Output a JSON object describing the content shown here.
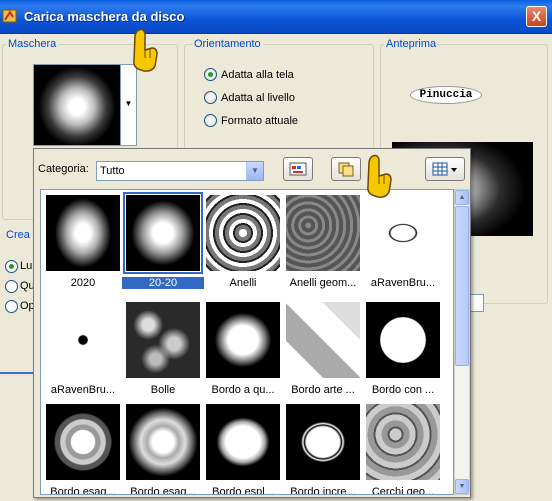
{
  "window": {
    "title": "Carica maschera da disco",
    "close_label": "X"
  },
  "maschera": {
    "label": "Maschera",
    "dropdown_glyph": "▼"
  },
  "orientamento": {
    "label": "Orientamento",
    "options": [
      {
        "label": "Adatta alla tela",
        "selected": true
      },
      {
        "label": "Adatta al livello",
        "selected": false
      },
      {
        "label": "Formato attuale",
        "selected": false
      }
    ]
  },
  "anteprima": {
    "label": "Anteprima",
    "signature": "Pinuccia"
  },
  "crea": {
    "label": "Crea",
    "options": [
      {
        "label": "Lu",
        "selected": true
      },
      {
        "label": "Qu",
        "selected": false
      },
      {
        "label": "Op",
        "selected": false
      }
    ]
  },
  "gallery": {
    "category_label": "Categoria:",
    "category_value": "Tutto",
    "toolbar_icons": [
      "edit-mask-icon",
      "copy-folder-icon",
      "view-options-icon"
    ],
    "items": [
      {
        "name": "2020",
        "selected": false
      },
      {
        "name": "20-20",
        "selected": true
      },
      {
        "name": "Anelli",
        "selected": false
      },
      {
        "name": "Anelli geom...",
        "selected": false
      },
      {
        "name": "aRavenBru...",
        "selected": false
      },
      {
        "name": "aRavenBru...",
        "selected": false
      },
      {
        "name": "Bolle",
        "selected": false
      },
      {
        "name": "Bordo a qu...",
        "selected": false
      },
      {
        "name": "Bordo arte ...",
        "selected": false
      },
      {
        "name": "Bordo con ...",
        "selected": false
      },
      {
        "name": "Bordo esag...",
        "selected": false
      },
      {
        "name": "Bordo esag...",
        "selected": false
      },
      {
        "name": "Bordo espl...",
        "selected": false
      },
      {
        "name": "Bordo incre...",
        "selected": false
      },
      {
        "name": "Cerchi geo...",
        "selected": false
      }
    ],
    "scroll": {
      "up_glyph": "▲",
      "down_glyph": "▼"
    }
  },
  "colors": {
    "title_bar": "#0a5fe0",
    "group_label": "#0046d5",
    "selection": "#316ac5",
    "hand_yellow": "#f5c800"
  }
}
